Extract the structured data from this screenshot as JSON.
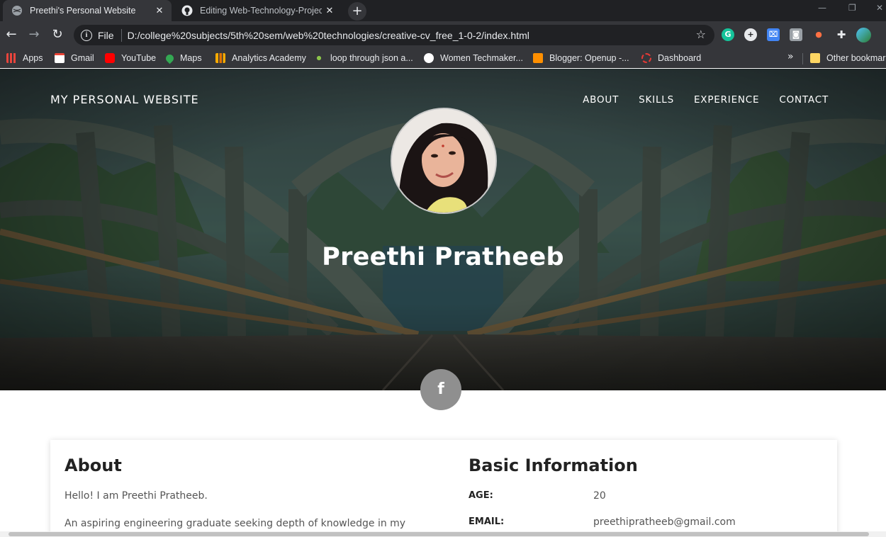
{
  "browser": {
    "tabs": [
      {
        "title": "Preethi's Personal Website",
        "active": true,
        "icon": "globe-icon"
      },
      {
        "title": "Editing Web-Technology-Projects",
        "active": false,
        "icon": "github-icon"
      }
    ],
    "new_tab_label": "+",
    "close_glyph": "✕",
    "window_controls": {
      "minimize": "—",
      "restore": "❐",
      "close": "✕"
    },
    "nav": {
      "back": "←",
      "forward": "→",
      "reload": "↻"
    },
    "address": {
      "scheme": "File",
      "url": "D:/college%20subjects/5th%20sem/web%20technologies/creative-cv_free_1-0-2/index.html",
      "info_glyph": "i",
      "star_glyph": "☆"
    },
    "extensions": [
      "G",
      "+",
      "⌧",
      "◙",
      "●",
      "✚"
    ],
    "bookmarks": [
      {
        "label": "Apps",
        "icon": "apps-grid-icon",
        "color": "#e8453c"
      },
      {
        "label": "Gmail",
        "icon": "gmail-icon",
        "color": "#ea4335"
      },
      {
        "label": "YouTube",
        "icon": "youtube-icon",
        "color": "#ff0000"
      },
      {
        "label": "Maps",
        "icon": "maps-pin-icon",
        "color": "#34a853"
      },
      {
        "label": "Analytics Academy",
        "icon": "analytics-icon",
        "color": "#f9ab00"
      },
      {
        "label": "loop through json a...",
        "icon": "star-burst-icon",
        "color": "#8bc34a"
      },
      {
        "label": "Women Techmaker...",
        "icon": "globe-icon",
        "color": "#ffffff"
      },
      {
        "label": "Blogger: Openup -...",
        "icon": "blogger-icon",
        "color": "#ff8f00"
      },
      {
        "label": "Dashboard",
        "icon": "dashboard-icon",
        "color": "#e53935"
      }
    ],
    "bookmarks_overflow": "»",
    "other_bookmarks": "Other bookmarks"
  },
  "site": {
    "brand": "MY PERSONAL WEBSITE",
    "menu": [
      "ABOUT",
      "SKILLS",
      "EXPERIENCE",
      "CONTACT"
    ],
    "hero_name": "Preethi Pratheeb",
    "social": {
      "facebook": "f"
    },
    "about": {
      "title": "About",
      "p1": "Hello! I am Preethi Pratheeb.",
      "p2": "An aspiring engineering graduate seeking depth of knowledge in my"
    },
    "info": {
      "title": "Basic Information",
      "rows": [
        {
          "key": "AGE:",
          "value": "20"
        },
        {
          "key": "EMAIL:",
          "value": "preethipratheeb@gmail.com"
        }
      ]
    }
  }
}
